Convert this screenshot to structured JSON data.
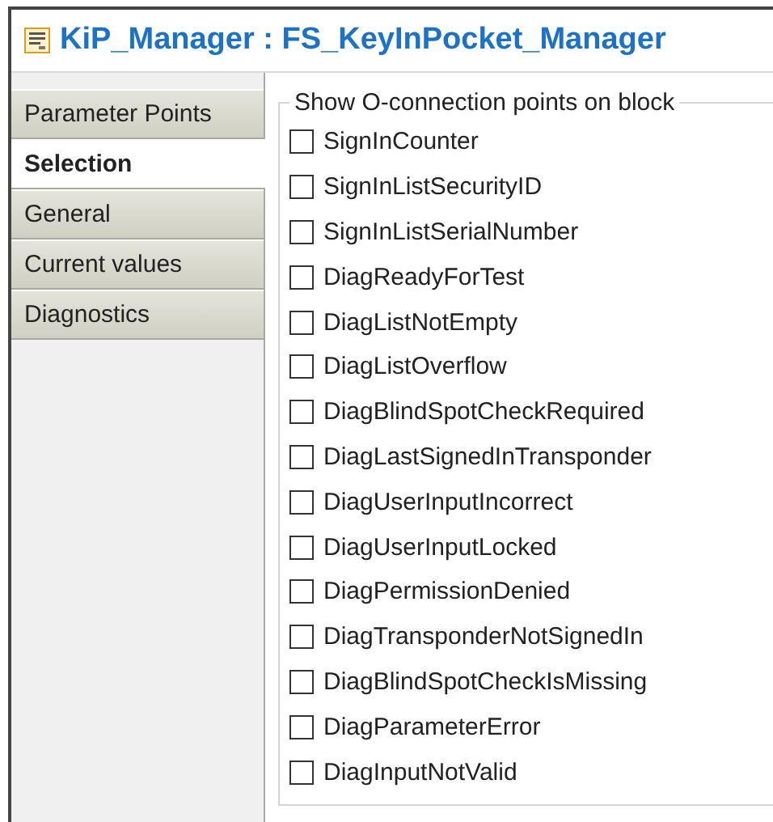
{
  "window": {
    "title": "KiP_Manager : FS_KeyInPocket_Manager"
  },
  "tabs": [
    {
      "label": "Parameter Points",
      "selected": false
    },
    {
      "label": "Selection",
      "selected": true
    },
    {
      "label": "General",
      "selected": false
    },
    {
      "label": "Current values",
      "selected": false
    },
    {
      "label": "Diagnostics",
      "selected": false
    }
  ],
  "group": {
    "title": "Show O-connection points on block",
    "items": [
      {
        "label": "SignInCounter",
        "checked": false
      },
      {
        "label": "SignInListSecurityID",
        "checked": false
      },
      {
        "label": "SignInListSerialNumber",
        "checked": false
      },
      {
        "label": "DiagReadyForTest",
        "checked": false
      },
      {
        "label": "DiagListNotEmpty",
        "checked": false
      },
      {
        "label": "DiagListOverflow",
        "checked": false
      },
      {
        "label": "DiagBlindSpotCheckRequired",
        "checked": false
      },
      {
        "label": "DiagLastSignedInTransponder",
        "checked": false
      },
      {
        "label": "DiagUserInputIncorrect",
        "checked": false
      },
      {
        "label": "DiagUserInputLocked",
        "checked": false
      },
      {
        "label": "DiagPermissionDenied",
        "checked": false
      },
      {
        "label": "DiagTransponderNotSignedIn",
        "checked": false
      },
      {
        "label": "DiagBlindSpotCheckIsMissing",
        "checked": false
      },
      {
        "label": "DiagParameterError",
        "checked": false
      },
      {
        "label": "DiagInputNotValid",
        "checked": false
      }
    ]
  }
}
